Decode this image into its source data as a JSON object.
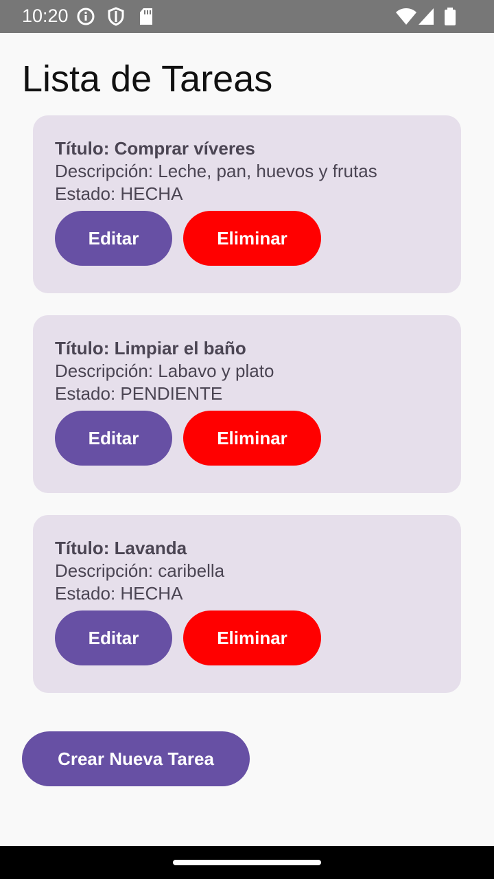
{
  "status_bar": {
    "time": "10:20",
    "left_icons": [
      "info-icon",
      "shield-icon",
      "sd-card-icon"
    ],
    "right_icons": [
      "wifi-icon",
      "signal-icon",
      "battery-icon"
    ]
  },
  "page": {
    "title": "Lista de Tareas"
  },
  "tasks": [
    {
      "title": "Título: Comprar víveres",
      "description": "Descripción: Leche, pan, huevos y frutas",
      "state": "Estado: HECHA",
      "edit_label": "Editar",
      "delete_label": "Eliminar"
    },
    {
      "title": "Título: Limpiar el baño",
      "description": "Descripción: Labavo y plato",
      "state": "Estado: PENDIENTE",
      "edit_label": "Editar",
      "delete_label": "Eliminar"
    },
    {
      "title": "Título: Lavanda",
      "description": "Descripción: caribella",
      "state": "Estado: HECHA",
      "edit_label": "Editar",
      "delete_label": "Eliminar"
    }
  ],
  "create_button": {
    "label": "Crear Nueva Tarea"
  },
  "colors": {
    "primary": "#6750a4",
    "danger": "#ff0000",
    "card_background": "#e6dfeb",
    "status_bar": "#777777"
  }
}
